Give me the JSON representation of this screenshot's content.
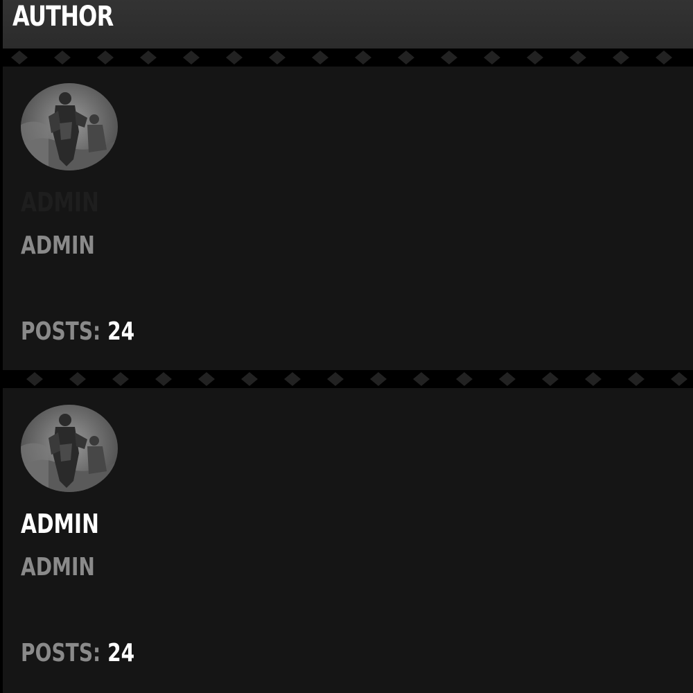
{
  "widget": {
    "title": "AUTHOR"
  },
  "authors": [
    {
      "name": "ADMIN",
      "role": "ADMIN",
      "posts_label": "POSTS:",
      "posts_count": "24",
      "avatar_icon": "soldier-avatar-image"
    },
    {
      "name": "ADMIN",
      "role": "ADMIN",
      "posts_label": "POSTS:",
      "posts_count": "24",
      "avatar_icon": "soldier-avatar-image"
    }
  ],
  "colors": {
    "page_background": "#000000",
    "header_background": "#2f2f2f",
    "card_background": "#151515",
    "name_text": "#ffffff",
    "muted_text": "#8a8a8a"
  }
}
